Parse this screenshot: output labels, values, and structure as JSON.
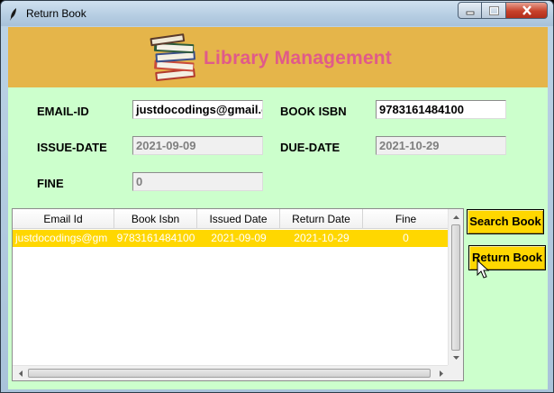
{
  "window": {
    "title": "Return Book",
    "icon": "feather-icon",
    "controls": [
      "minimize-icon",
      "maximize-icon",
      "close-icon"
    ]
  },
  "header": {
    "title": "Library Management",
    "icon": "books-stack-icon",
    "background": "#e5b54a",
    "title_color": "#e05a8a"
  },
  "form": {
    "email_label": "EMAIL-ID",
    "email_value": "justdocodings@gmail.c",
    "isbn_label": "BOOK ISBN",
    "isbn_value": "9783161484100",
    "issue_label": "ISSUE-DATE",
    "issue_value": "2021-09-09",
    "due_label": "DUE-DATE",
    "due_value": "2021-10-29",
    "fine_label": "FINE",
    "fine_value": "0"
  },
  "table": {
    "columns": [
      "Email Id",
      "Book Isbn",
      "Issued Date",
      "Return Date",
      "Fine"
    ],
    "rows": [
      [
        "justdocodings@gm",
        "9783161484100",
        "2021-09-09",
        "2021-10-29",
        "0"
      ]
    ],
    "selected_row_color": "#ffd700"
  },
  "buttons": {
    "search": "Search Book",
    "return": "Return Book"
  },
  "colors": {
    "background": "#ccffcc",
    "button": "#ffd700"
  }
}
